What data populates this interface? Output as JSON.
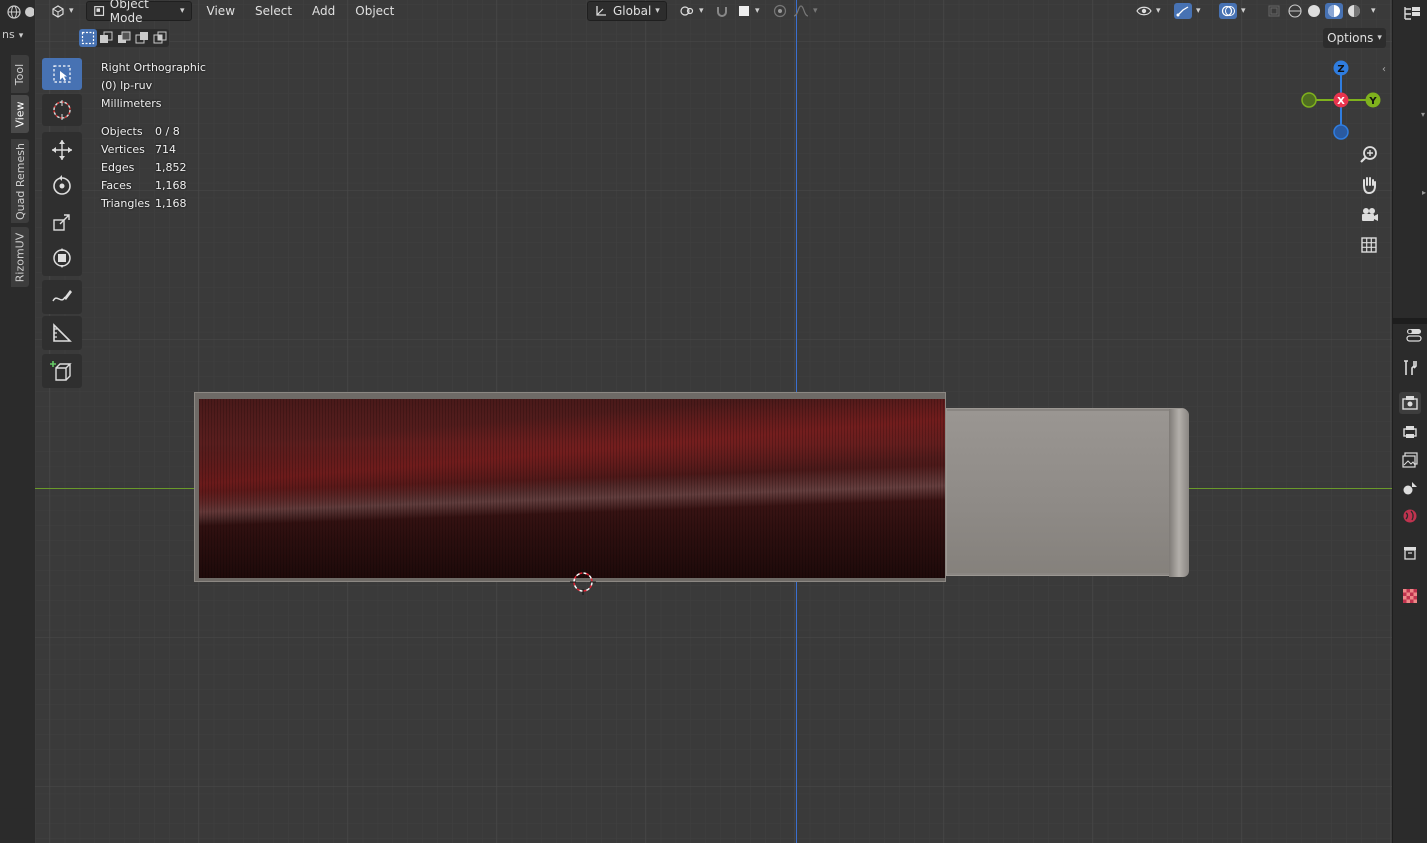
{
  "header": {
    "mode_label": "Object Mode",
    "menus": [
      "View",
      "Select",
      "Add",
      "Object"
    ],
    "orientation_label": "Global"
  },
  "left_strip": {
    "dropdown_text": "ns",
    "tabs": [
      "Tool",
      "View",
      "Quad Remesh",
      "RizomUV"
    ],
    "active_tab": "View"
  },
  "options_label": "Options",
  "overlay": {
    "view_name": "Right Orthographic",
    "object_name": "(0) lp-ruv",
    "units": "Millimeters",
    "stats": [
      {
        "label": "Objects",
        "value": "0 / 8"
      },
      {
        "label": "Vertices",
        "value": "714"
      },
      {
        "label": "Edges",
        "value": "1,852"
      },
      {
        "label": "Faces",
        "value": "1,168"
      },
      {
        "label": "Triangles",
        "value": "1,168"
      }
    ]
  },
  "gizmo": {
    "z_label": "Z",
    "x_label": "X",
    "y_label": "Y",
    "z_color": "#2f7de0",
    "x_color": "#e8344e",
    "y_color": "#7fb21d"
  },
  "colors": {
    "accent": "#4772b3",
    "x_axis_line": "#6a9a2a",
    "z_axis_line": "#3a6fd0"
  }
}
